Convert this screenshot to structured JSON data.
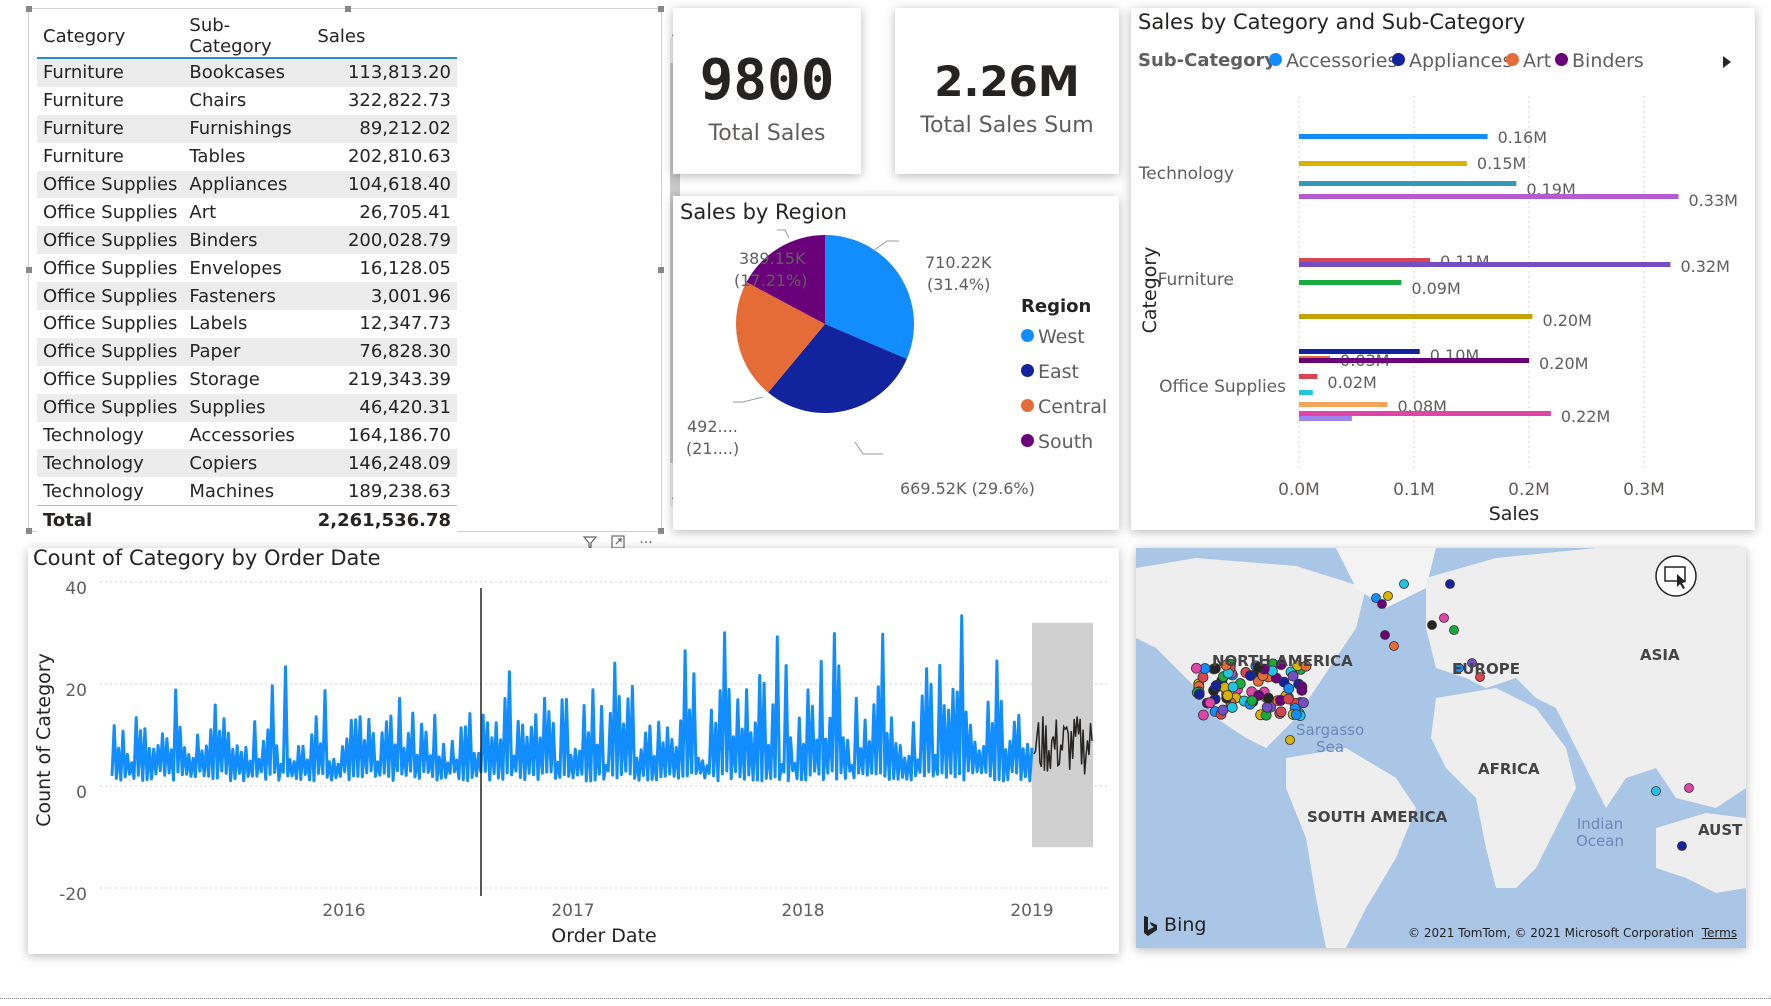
{
  "table": {
    "headers": {
      "category": "Category",
      "sub_category": "Sub-Category",
      "sales": "Sales"
    },
    "rows": [
      {
        "category": "Furniture",
        "sub_category": "Bookcases",
        "sales": "113,813.20"
      },
      {
        "category": "Furniture",
        "sub_category": "Chairs",
        "sales": "322,822.73"
      },
      {
        "category": "Furniture",
        "sub_category": "Furnishings",
        "sales": "89,212.02"
      },
      {
        "category": "Furniture",
        "sub_category": "Tables",
        "sales": "202,810.63"
      },
      {
        "category": "Office Supplies",
        "sub_category": "Appliances",
        "sales": "104,618.40"
      },
      {
        "category": "Office Supplies",
        "sub_category": "Art",
        "sales": "26,705.41"
      },
      {
        "category": "Office Supplies",
        "sub_category": "Binders",
        "sales": "200,028.79"
      },
      {
        "category": "Office Supplies",
        "sub_category": "Envelopes",
        "sales": "16,128.05"
      },
      {
        "category": "Office Supplies",
        "sub_category": "Fasteners",
        "sales": "3,001.96"
      },
      {
        "category": "Office Supplies",
        "sub_category": "Labels",
        "sales": "12,347.73"
      },
      {
        "category": "Office Supplies",
        "sub_category": "Paper",
        "sales": "76,828.30"
      },
      {
        "category": "Office Supplies",
        "sub_category": "Storage",
        "sales": "219,343.39"
      },
      {
        "category": "Office Supplies",
        "sub_category": "Supplies",
        "sales": "46,420.31"
      },
      {
        "category": "Technology",
        "sub_category": "Accessories",
        "sales": "164,186.70"
      },
      {
        "category": "Technology",
        "sub_category": "Copiers",
        "sales": "146,248.09"
      },
      {
        "category": "Technology",
        "sub_category": "Machines",
        "sales": "189,238.63"
      }
    ],
    "total_label": "Total",
    "total_value": "2,261,536.78",
    "scroll_up_icon": "chevron-up-icon",
    "scroll_down_icon": "chevron-down-icon"
  },
  "kpi_count": {
    "value": "9800",
    "label": "Total Sales"
  },
  "kpi_sum": {
    "value": "2.26M",
    "label": "Total Sales Sum"
  },
  "pie": {
    "title": "Sales by Region",
    "legend_title": "Region",
    "colors": {
      "West": "#118DFF",
      "East": "#12239E",
      "Central": "#E66C37",
      "South": "#6B007B"
    },
    "labels": {
      "west_a": "710.22K",
      "west_b": "(31.4%)",
      "east": "669.52K (29.6%)",
      "central_a": "492....",
      "central_b": "(21....)",
      "south_a": "389.15K",
      "south_b": "(17.21%)"
    },
    "legend": [
      "West",
      "East",
      "Central",
      "South"
    ]
  },
  "bar": {
    "title": "Sales by Category and Sub-Category",
    "legend_title": "Sub-Category",
    "legend": [
      {
        "name": "Accessories",
        "color": "#118DFF"
      },
      {
        "name": "Appliances",
        "color": "#12239E"
      },
      {
        "name": "Art",
        "color": "#E66C37"
      },
      {
        "name": "Binders",
        "color": "#6B007B"
      }
    ],
    "legend_next_icon": "triangle-right-icon",
    "y_title": "Category",
    "x_title": "Sales",
    "x_ticks": [
      "0.0M",
      "0.1M",
      "0.2M",
      "0.3M"
    ]
  },
  "line": {
    "title": "Count of Category by Order Date",
    "y_title": "Count of Category",
    "x_title": "Order Date",
    "y_ticks": [
      "40",
      "20",
      "0",
      "-20"
    ],
    "x_ticks": [
      "2016",
      "2017",
      "2018",
      "2019"
    ],
    "toolbar_icons": [
      "filter-icon",
      "focus-mode-icon",
      "more-options-icon"
    ],
    "more_glyph": "···"
  },
  "map": {
    "labels": {
      "north_america": "NORTH AMERICA",
      "europe": "EUROPE",
      "asia": "ASIA",
      "africa": "AFRICA",
      "south_america": "SOUTH AMERICA",
      "australia": "AUST",
      "sargasso_a": "Sargasso",
      "sargasso_b": "Sea",
      "indian_a": "Indian",
      "indian_b": "Ocean"
    },
    "bing": "Bing",
    "copyright": "© 2021 TomTom, © 2021 Microsoft Corporation",
    "terms": "Terms",
    "select_icon": "map-select-icon"
  },
  "chart_data": [
    {
      "type": "pie",
      "title": "Sales by Region",
      "categories": [
        "West",
        "East",
        "Central",
        "South"
      ],
      "values": [
        710.22,
        669.52,
        492.0,
        389.15
      ],
      "percent": [
        31.4,
        29.6,
        21.79,
        17.21
      ],
      "legend_title": "Region",
      "legend_position": "right"
    },
    {
      "type": "bar",
      "orientation": "horizontal",
      "title": "Sales by Category and Sub-Category",
      "categories": [
        "Technology",
        "Furniture",
        "Office Supplies"
      ],
      "series": [
        {
          "name": "Technology bars",
          "values": [
            {
              "label": "0.16M",
              "value": 0.164,
              "color": "#118DFF"
            },
            {
              "label": "0.15M",
              "value": 0.146,
              "color": "#D9B300"
            },
            {
              "label": "0.19M",
              "value": 0.189,
              "color": "#3599B8"
            },
            {
              "label": "0.33M",
              "value": 0.33,
              "color": "#B45BD1"
            }
          ]
        },
        {
          "name": "Furniture bars",
          "values": [
            {
              "label": "0.11M",
              "value": 0.114,
              "color": "#D64550"
            },
            {
              "label": "0.32M",
              "value": 0.323,
              "color": "#744EC2"
            },
            {
              "label": "0.09M",
              "value": 0.089,
              "color": "#1AAB40"
            },
            {
              "label": "0.20M",
              "value": 0.203,
              "color": "#C4A200"
            }
          ]
        },
        {
          "name": "Office Supplies bars",
          "values": [
            {
              "label": "0.10M",
              "value": 0.105,
              "color": "#12239E"
            },
            {
              "label": "0.03M",
              "value": 0.027,
              "color": "#E66C37"
            },
            {
              "label": "0.20M",
              "value": 0.2,
              "color": "#6B007B"
            },
            {
              "label": "0.02M",
              "value": 0.016,
              "color": "#D64550"
            },
            {
              "label": "",
              "value": 0.012,
              "color": "#20C5E0"
            },
            {
              "label": "0.08M",
              "value": 0.077,
              "color": "#F5A55A"
            },
            {
              "label": "0.22M",
              "value": 0.219,
              "color": "#E044A7"
            },
            {
              "label": "",
              "value": 0.046,
              "color": "#9B85F0"
            }
          ]
        }
      ],
      "xlabel": "Sales",
      "ylabel": "Category",
      "xlim": [
        0,
        0.35
      ],
      "legend_position": "top"
    },
    {
      "type": "line",
      "title": "Count of Category by Order Date",
      "xlabel": "Order Date",
      "ylabel": "Count of Category",
      "xlim": [
        "2015-01-01",
        "2019-04-01"
      ],
      "ylim": [
        -20,
        40
      ],
      "series": [
        {
          "name": "Count of Category",
          "color": "#118DFF",
          "x": [
            "2015-01",
            "2015-04",
            "2015-07",
            "2015-10",
            "2016-01",
            "2016-04",
            "2016-07",
            "2016-10",
            "2017-01",
            "2017-04",
            "2017-07",
            "2017-10",
            "2018-01",
            "2018-04",
            "2018-07",
            "2018-10",
            "2018-12"
          ],
          "y_min": 1,
          "y_max": [
            18,
            20,
            22,
            27,
            22,
            24,
            23,
            30,
            28,
            26,
            30,
            38,
            34,
            33,
            30,
            34,
            32
          ]
        },
        {
          "name": "forecast",
          "color": "#252423",
          "x": [
            "2019-01",
            "2019-03"
          ],
          "range": [
            2,
            14
          ]
        }
      ],
      "forecast_band": [
        -12,
        32
      ],
      "grid": true
    }
  ]
}
